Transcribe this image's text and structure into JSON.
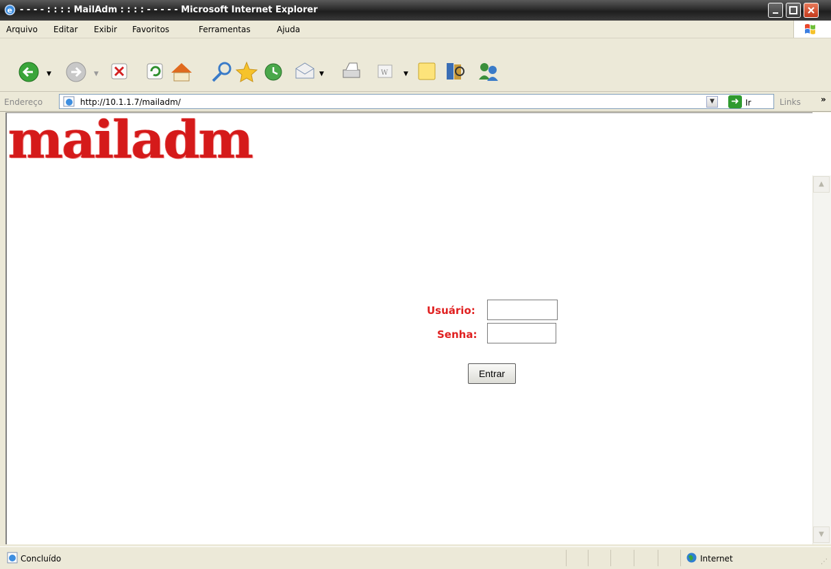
{
  "window": {
    "title": "- - - - : : : : MailAdm : : : : - - - - - Microsoft Internet Explorer"
  },
  "menu": {
    "items": [
      "Arquivo",
      "Editar",
      "Exibir",
      "Favoritos",
      "Ferramentas",
      "Ajuda"
    ]
  },
  "address": {
    "label": "Endereço",
    "url": "http://10.1.1.7/mailadm/",
    "go_label": "Ir",
    "links_label": "Links"
  },
  "page": {
    "logo_text": "mailadm",
    "username_label": "Usuário:",
    "password_label": "Senha:",
    "username_value": "",
    "password_value": "",
    "submit_label": "Entrar",
    "label_color": "#e02020",
    "logo_color": "#d51a1a"
  },
  "status": {
    "text": "Concluído",
    "zone": "Internet"
  }
}
